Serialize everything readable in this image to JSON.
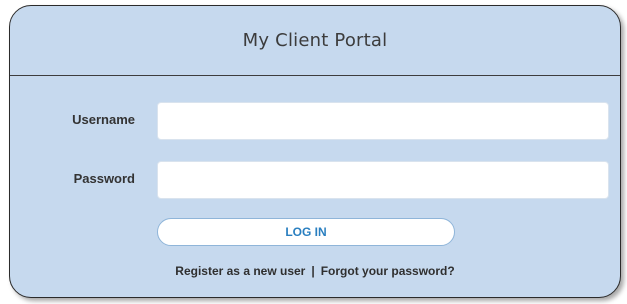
{
  "header": {
    "title": "My Client Portal"
  },
  "form": {
    "username_label": "Username",
    "username_value": "",
    "password_label": "Password",
    "password_value": "",
    "login_label": "LOG IN"
  },
  "links": {
    "register": "Register as a new user",
    "separator": "|",
    "forgot": "Forgot your password?"
  },
  "colors": {
    "panel_background": "#c6d9ee",
    "button_text": "#2a7fc0"
  }
}
